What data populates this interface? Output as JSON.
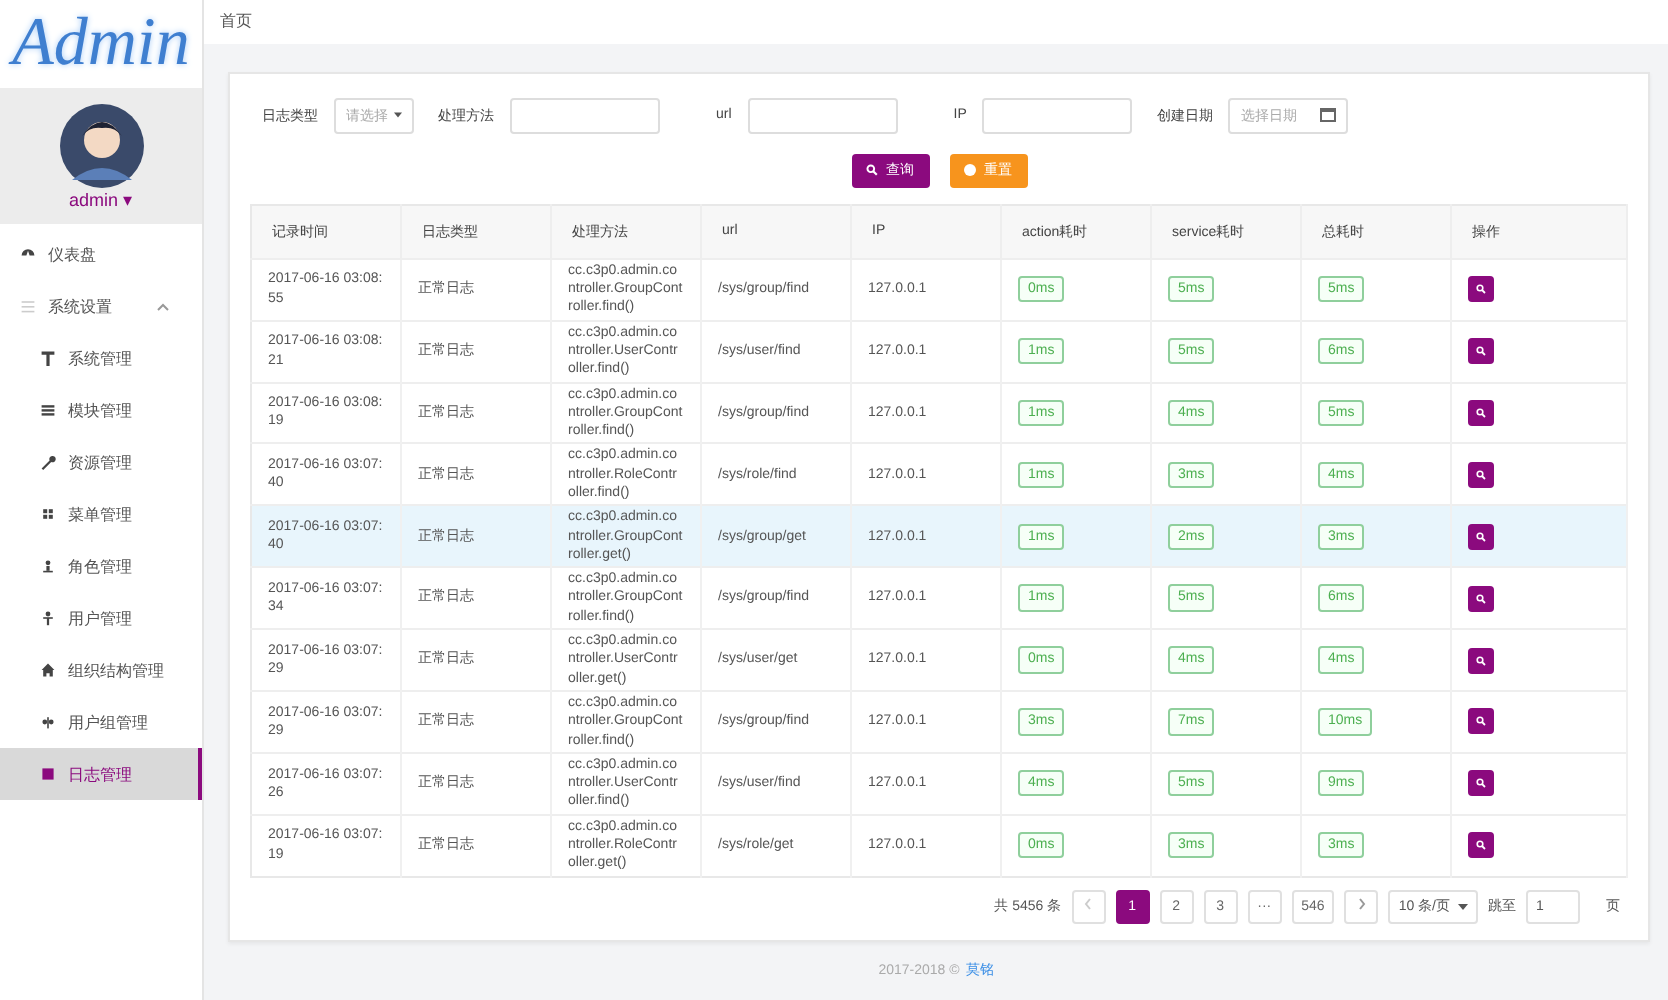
{
  "sidebar": {
    "logo": "Admin",
    "user": {
      "name": "admin",
      "caret": "▾"
    },
    "menu": [
      {
        "label": "仪表盘",
        "kind": "dashboard",
        "selected": false
      },
      {
        "label": "系统设置",
        "kind": "list",
        "expanded": true,
        "selected": false,
        "children": [
          {
            "label": "系统管理",
            "kind": "tool",
            "selected": false
          },
          {
            "label": "模块管理",
            "kind": "bars",
            "selected": false
          },
          {
            "label": "资源管理",
            "kind": "wrench",
            "selected": false
          },
          {
            "label": "菜单管理",
            "kind": "grid",
            "selected": false
          },
          {
            "label": "角色管理",
            "kind": "person",
            "selected": false
          },
          {
            "label": "用户管理",
            "kind": "user",
            "selected": false
          },
          {
            "label": "组织结构管理",
            "kind": "home",
            "selected": false
          },
          {
            "label": "用户组管理",
            "kind": "group",
            "selected": false
          },
          {
            "label": "日志管理",
            "kind": "square",
            "selected": true
          }
        ]
      }
    ]
  },
  "breadcrumb": "首页",
  "filters": [
    {
      "label": "日志类型",
      "kind": "select",
      "placeholder": "请选择"
    },
    {
      "label": "处理方法",
      "kind": "text"
    },
    {
      "label": "url",
      "kind": "text"
    },
    {
      "label": "IP",
      "kind": "text"
    },
    {
      "label": "创建日期",
      "kind": "date",
      "placeholder": "选择日期"
    }
  ],
  "buttons": [
    {
      "label": "查询",
      "kind": "search"
    },
    {
      "label": "重置",
      "kind": "reset"
    }
  ],
  "table": {
    "columns": [
      "记录时间",
      "日志类型",
      "处理方法",
      "url",
      "IP",
      "action耗时",
      "service耗时",
      "总耗时",
      "操作"
    ],
    "rows": [
      {
        "time": "2017-06-16 03:08:55",
        "type": "正常日志",
        "method": "cc.c3p0.admin.controller.GroupController.find()",
        "url": "/sys/group/find",
        "ip": "127.0.0.1",
        "action": "0ms",
        "service": "5ms",
        "total": "5ms",
        "selected": false
      },
      {
        "time": "2017-06-16 03:08:21",
        "type": "正常日志",
        "method": "cc.c3p0.admin.controller.UserController.find()",
        "url": "/sys/user/find",
        "ip": "127.0.0.1",
        "action": "1ms",
        "service": "5ms",
        "total": "6ms",
        "selected": false
      },
      {
        "time": "2017-06-16 03:08:19",
        "type": "正常日志",
        "method": "cc.c3p0.admin.controller.GroupController.find()",
        "url": "/sys/group/find",
        "ip": "127.0.0.1",
        "action": "1ms",
        "service": "4ms",
        "total": "5ms",
        "selected": false
      },
      {
        "time": "2017-06-16 03:07:40",
        "type": "正常日志",
        "method": "cc.c3p0.admin.controller.RoleController.find()",
        "url": "/sys/role/find",
        "ip": "127.0.0.1",
        "action": "1ms",
        "service": "3ms",
        "total": "4ms",
        "selected": false
      },
      {
        "time": "2017-06-16 03:07:40",
        "type": "正常日志",
        "method": "cc.c3p0.admin.controller.GroupController.get()",
        "url": "/sys/group/get",
        "ip": "127.0.0.1",
        "action": "1ms",
        "service": "2ms",
        "total": "3ms",
        "selected": true
      },
      {
        "time": "2017-06-16 03:07:34",
        "type": "正常日志",
        "method": "cc.c3p0.admin.controller.GroupController.find()",
        "url": "/sys/group/find",
        "ip": "127.0.0.1",
        "action": "1ms",
        "service": "5ms",
        "total": "6ms",
        "selected": false
      },
      {
        "time": "2017-06-16 03:07:29",
        "type": "正常日志",
        "method": "cc.c3p0.admin.controller.UserController.get()",
        "url": "/sys/user/get",
        "ip": "127.0.0.1",
        "action": "0ms",
        "service": "4ms",
        "total": "4ms",
        "selected": false
      },
      {
        "time": "2017-06-16 03:07:29",
        "type": "正常日志",
        "method": "cc.c3p0.admin.controller.GroupController.find()",
        "url": "/sys/group/find",
        "ip": "127.0.0.1",
        "action": "3ms",
        "service": "7ms",
        "total": "10ms",
        "selected": false
      },
      {
        "time": "2017-06-16 03:07:26",
        "type": "正常日志",
        "method": "cc.c3p0.admin.controller.UserController.find()",
        "url": "/sys/user/find",
        "ip": "127.0.0.1",
        "action": "4ms",
        "service": "5ms",
        "total": "9ms",
        "selected": false
      },
      {
        "time": "2017-06-16 03:07:19",
        "type": "正常日志",
        "method": "cc.c3p0.admin.controller.RoleController.get()",
        "url": "/sys/role/get",
        "ip": "127.0.0.1",
        "action": "0ms",
        "service": "3ms",
        "total": "3ms",
        "selected": false
      }
    ]
  },
  "pagination": {
    "total": "共 5456 条",
    "pages": [
      {
        "label": "1",
        "selected": true
      },
      {
        "label": "2",
        "selected": false
      },
      {
        "label": "3",
        "selected": false
      },
      {
        "label": "···",
        "selected": false
      },
      {
        "label": "546",
        "selected": false
      }
    ],
    "page_size": "10 条/页",
    "jump_label": "跳至",
    "jump_value": "1",
    "page_unit": "页"
  },
  "footer": {
    "text": "2017-2018 ©",
    "link": "莫铭"
  }
}
